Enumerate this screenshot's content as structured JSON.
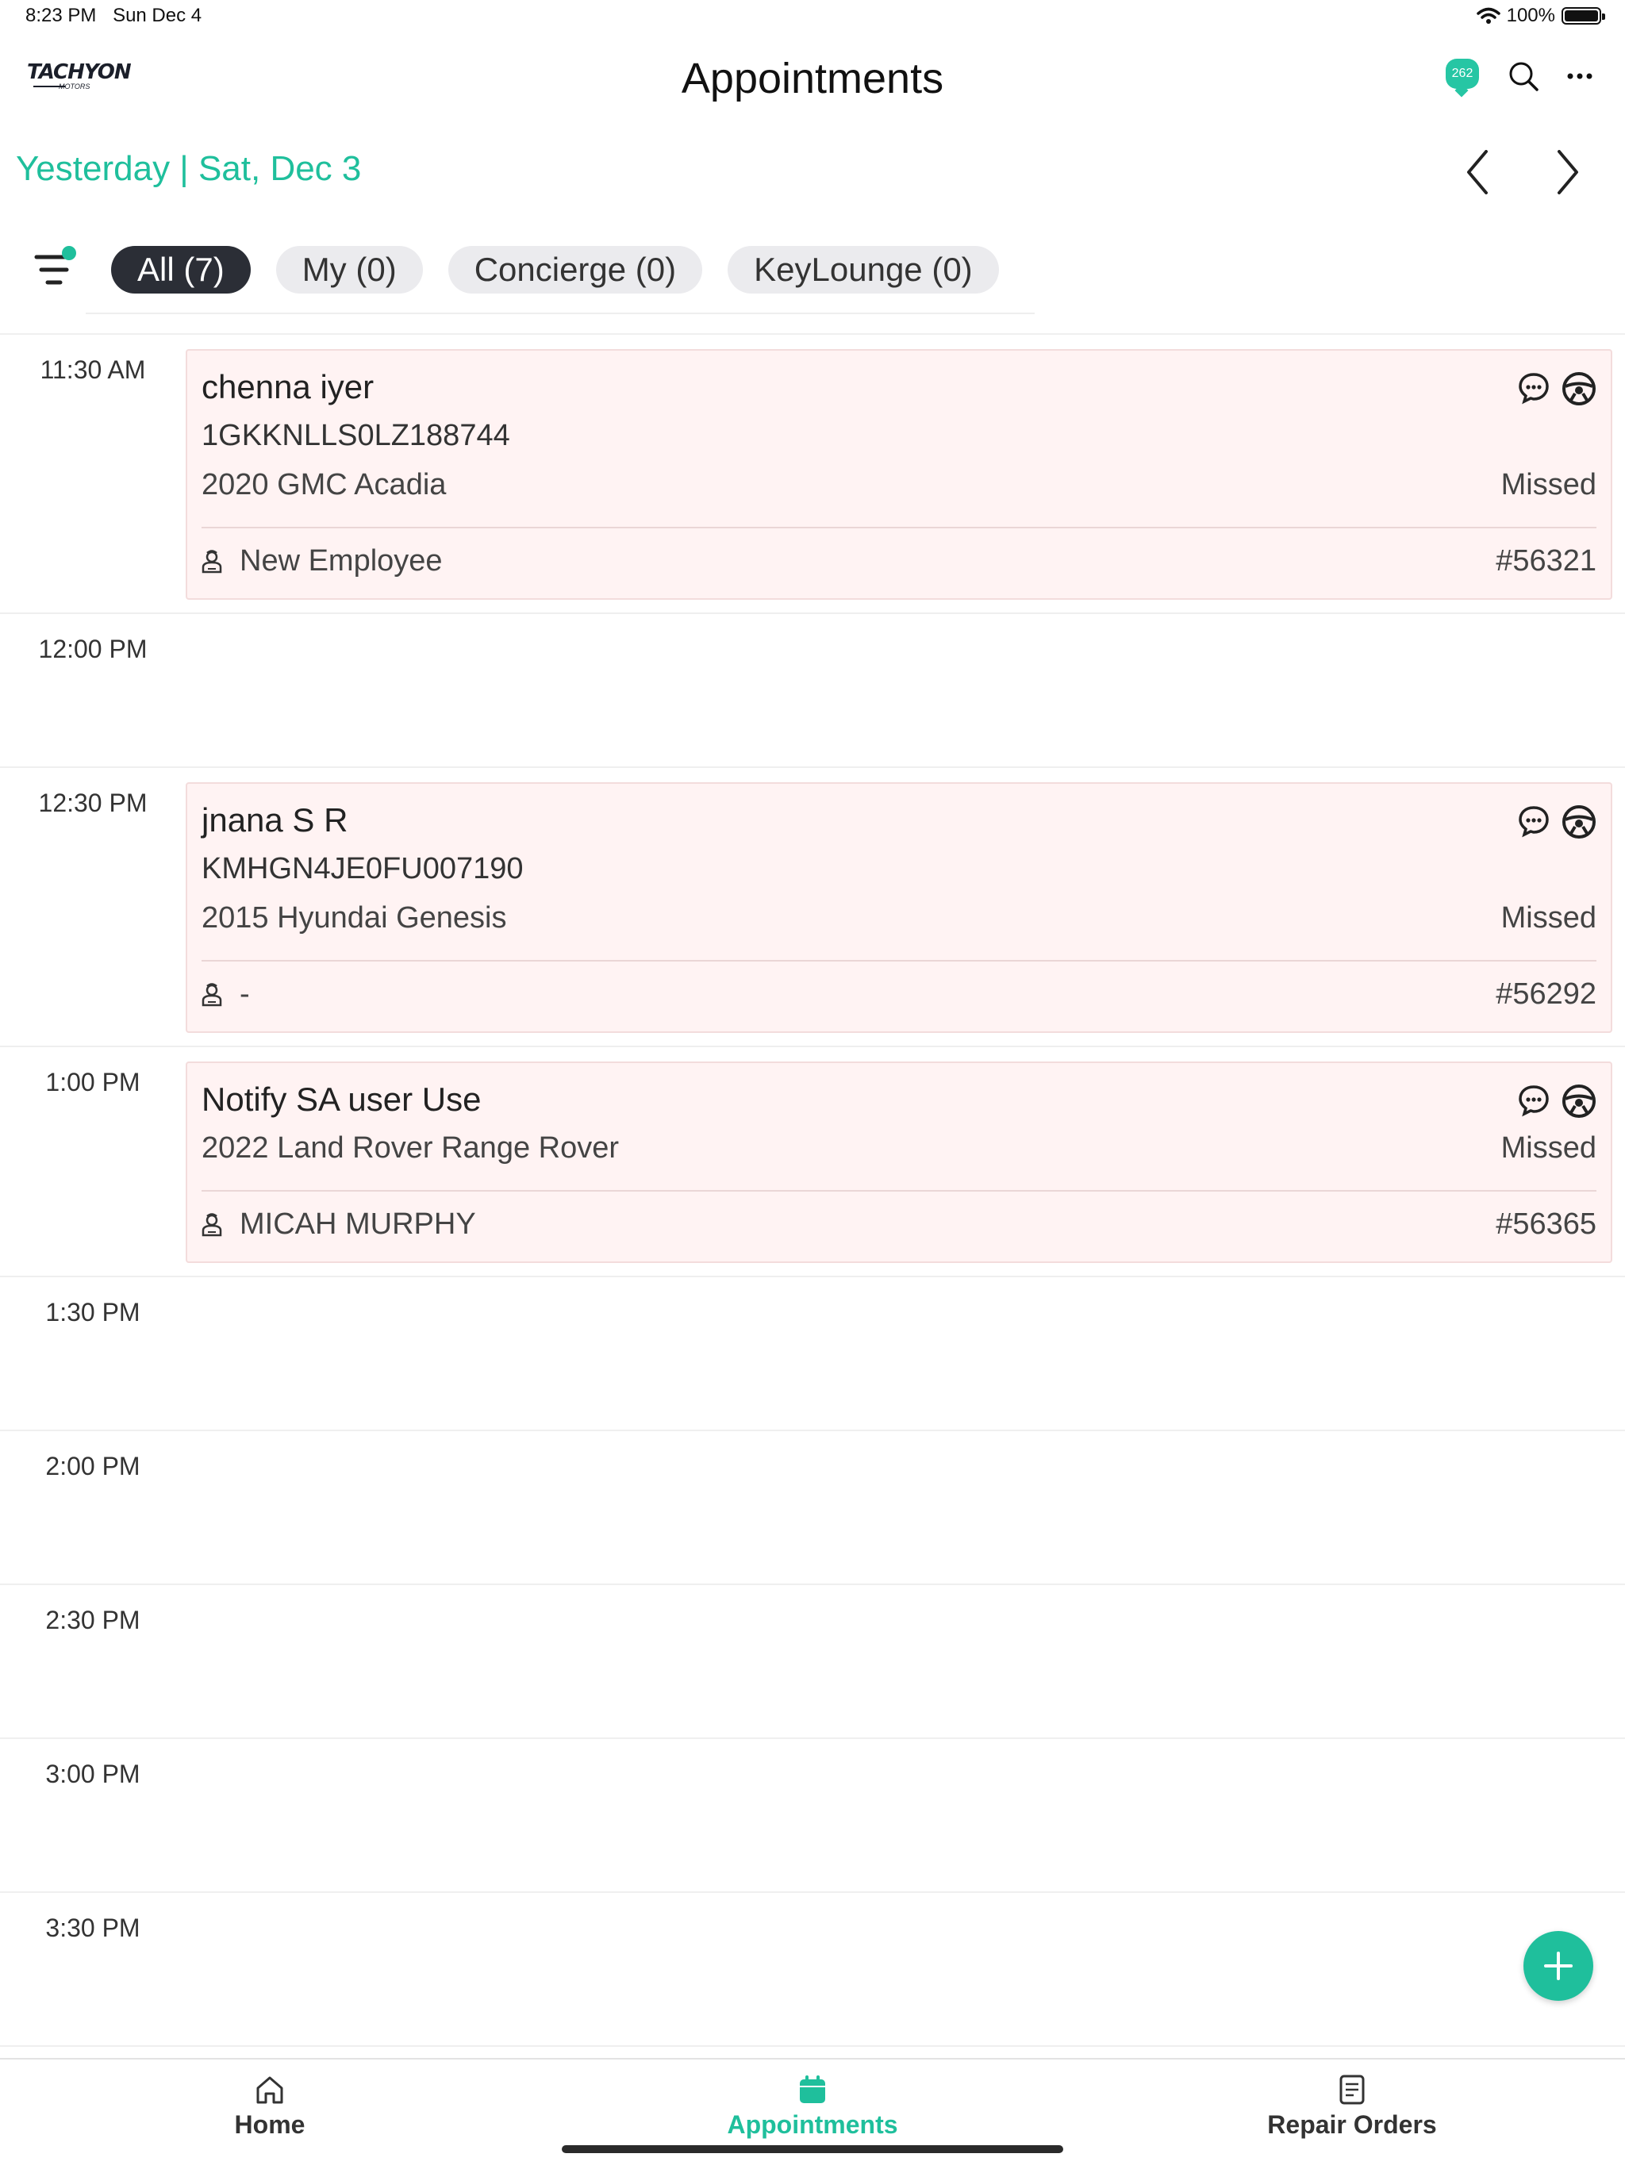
{
  "status_bar": {
    "time": "8:23 PM",
    "date": "Sun Dec 4",
    "battery": "100%"
  },
  "header": {
    "logo_main": "TACHYON",
    "logo_sub": "MOTORS",
    "title": "Appointments",
    "chat_badge_count": "262",
    "icons": [
      "chat-icon",
      "search-icon",
      "more-icon"
    ]
  },
  "date_nav": {
    "label": "Yesterday | Sat, Dec 3"
  },
  "filters": {
    "chips": [
      {
        "label": "All (7)",
        "active": true
      },
      {
        "label": "My (0)",
        "active": false
      },
      {
        "label": "Concierge (0)",
        "active": false
      },
      {
        "label": "KeyLounge (0)",
        "active": false
      }
    ]
  },
  "time_slots": [
    "11:30 AM",
    "12:00 PM",
    "12:30 PM",
    "1:00 PM",
    "1:30 PM",
    "2:00 PM",
    "2:30 PM",
    "3:00 PM",
    "3:30 PM"
  ],
  "appointments": [
    {
      "name": "chenna iyer",
      "vin": "1GKKNLLS0LZ188744",
      "vehicle": "2020 GMC Acadia",
      "status": "Missed",
      "advisor": "New Employee",
      "ro_number": "#56321"
    },
    {
      "name": "jnana S R",
      "vin": "KMHGN4JE0FU007190",
      "vehicle": "2015 Hyundai Genesis",
      "status": "Missed",
      "advisor": "-",
      "ro_number": "#56292"
    },
    {
      "name": "Notify SA user Use",
      "vehicle": "2022 Land Rover Range Rover",
      "status": "Missed",
      "advisor": "MICAH MURPHY",
      "ro_number": "#56365"
    }
  ],
  "tabbar": {
    "tabs": [
      {
        "label": "Home",
        "icon": "home-icon",
        "active": false
      },
      {
        "label": "Appointments",
        "icon": "calendar-icon",
        "active": true
      },
      {
        "label": "Repair Orders",
        "icon": "document-icon",
        "active": false
      }
    ]
  },
  "colors": {
    "accent": "#1fbf9c",
    "card_bg": "#fff3f3",
    "chip_active": "#2b2e36"
  }
}
